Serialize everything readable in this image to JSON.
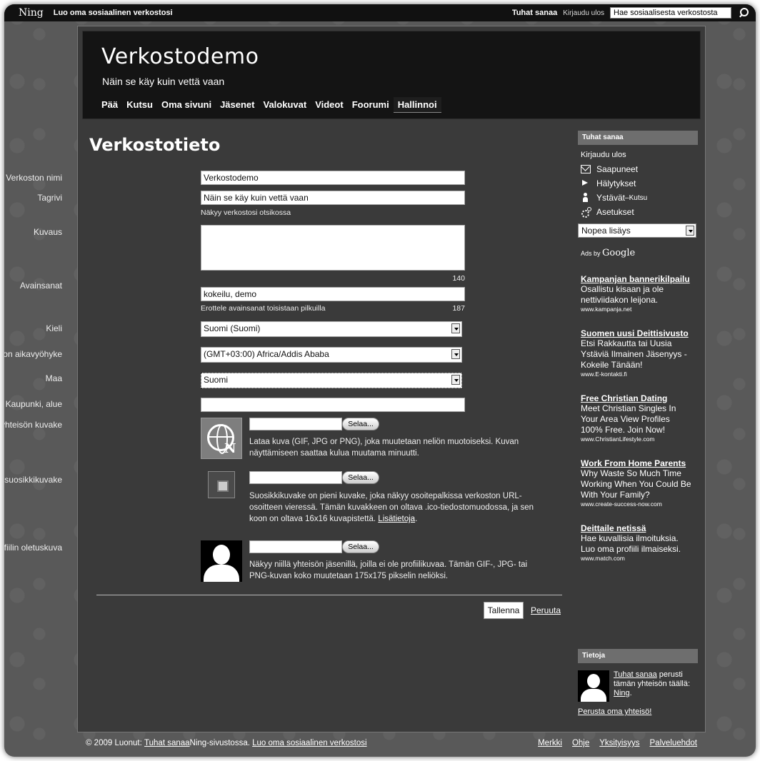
{
  "ningbar": {
    "logo": "Ning",
    "create_network": "Luo oma sosiaalinen verkostosi",
    "user": "Tuhat sanaa",
    "logout": "Kirjaudu ulos",
    "search_value": "Hae sosiaalisesta verkostosta"
  },
  "header": {
    "title": "Verkostodemo",
    "tagline": "Näin se käy kuin vettä vaan",
    "nav": [
      "Pää",
      "Kutsu",
      "Oma sivuni",
      "Jäsenet",
      "Valokuvat",
      "Videot",
      "Foorumi",
      "Hallinnoi"
    ],
    "active_nav": "Hallinnoi"
  },
  "page": {
    "title": "Verkostotieto",
    "fields": {
      "name_label": "Verkoston nimi",
      "name_value": "Verkostodemo",
      "tagline_label": "Tagrivi",
      "tagline_value": "Näin se käy kuin vettä vaan",
      "tagline_help": "Näkyy verkostosi otsikossa",
      "description_label": "Kuvaus",
      "description_value": "",
      "description_counter": "140",
      "keywords_label": "Avainsanat",
      "keywords_value": "kokeilu, demo",
      "keywords_help": "Erottele avainsanat toisistaan pilkuilla",
      "keywords_counter": "187",
      "language_label": "Kieli",
      "language_value": "Suomi (Suomi)",
      "timezone_label": "Verkoston aikavyöhyke",
      "timezone_value": "(GMT+03:00) Africa/Addis Ababa",
      "country_label": "Maa",
      "country_value": "Suomi",
      "city_label": "Kaupunki, alue",
      "city_value": ""
    },
    "uploads": {
      "icon_label": "Aseta yhteisön kuvake",
      "icon_text": "Lataa kuva (GIF, JPG or PNG), joka muutetaan neliön muotoiseksi. Kuvan näyttämiseen saattaa kulua muutama minuutti.",
      "favicon_label": "Määritä suosikkikuvake",
      "favicon_text": "Suosikkikuvake on pieni kuvake, joka näkyy osoitepalkissa verkoston URL-osoitteen vieressä. Tämän kuvakkeen on oltava .ico-tiedostomuodossa, ja sen koon on oltava 16x16 kuvapistettä.",
      "favicon_link": "Lisätietoja",
      "favicon_suffix": ".",
      "avatar_label": "Aseta profiilin oletuskuva",
      "avatar_text": "Näkyy niillä yhteisön jäsenillä, joilla ei ole profiilikuvaa. Tämän GIF-, JPG- tai PNG-kuvan koko muutetaan 175x175 pikselin neliöksi.",
      "browse": "Selaa..."
    },
    "save": "Tallenna",
    "cancel": "Peruuta"
  },
  "sidebar": {
    "user_head": "Tuhat sanaa",
    "logout": "Kirjaudu ulos",
    "inbox": "Saapuneet",
    "alerts": "Hälytykset",
    "friends": "Ystävät",
    "friends_dash": " – ",
    "invite": "Kutsu",
    "settings": "Asetukset",
    "quick_add": "Nopea lisäys",
    "ads_by": "Ads by ",
    "ads_google": "Google",
    "ads": [
      {
        "title": "Kampanjan bannerikilpailu",
        "body": "Osallistu kisaan ja ole nettiviidakon leijona.",
        "url": "www.kampanja.net"
      },
      {
        "title": "Suomen uusi Deittisivusto",
        "body": "Etsi Rakkautta tai Uusia Ystäviä Ilmainen Jäsenyys - Kokeile Tänään!",
        "url": "www.E-kontakti.fi"
      },
      {
        "title": "Free Christian Dating",
        "body": "Meet Christian Singles In Your Area View Profiles 100% Free. Join Now!",
        "url": "www.ChristianLifestyle.com"
      },
      {
        "title": "Work From Home Parents",
        "body": "Why Waste So Much Time Working When You Could Be With Your Family?",
        "url": "www.create-success-now.com"
      },
      {
        "title": "Deittaile netissä",
        "body": "Hae kuvallisia ilmoituksia. Luo oma profiili ilmaiseksi.",
        "url": "www.match.com"
      }
    ],
    "info_head": "Tietoja",
    "info_user": "Tuhat sanaa",
    "info_text": " perusti tämän yhteisön täällä: ",
    "info_ning": "Ning",
    "info_dot": ".",
    "info_found": "Perusta oma yhteisö!"
  },
  "footer": {
    "copyright": "© 2009  Luonut: ",
    "author": "Tuhat sanaa",
    "in_ning": " Ning-sivustossa.  ",
    "create": "Luo oma sosiaalinen verkostosi",
    "links": [
      "Merkki",
      "Ohje",
      "Yksityisyys",
      "Palveluehdot"
    ]
  }
}
